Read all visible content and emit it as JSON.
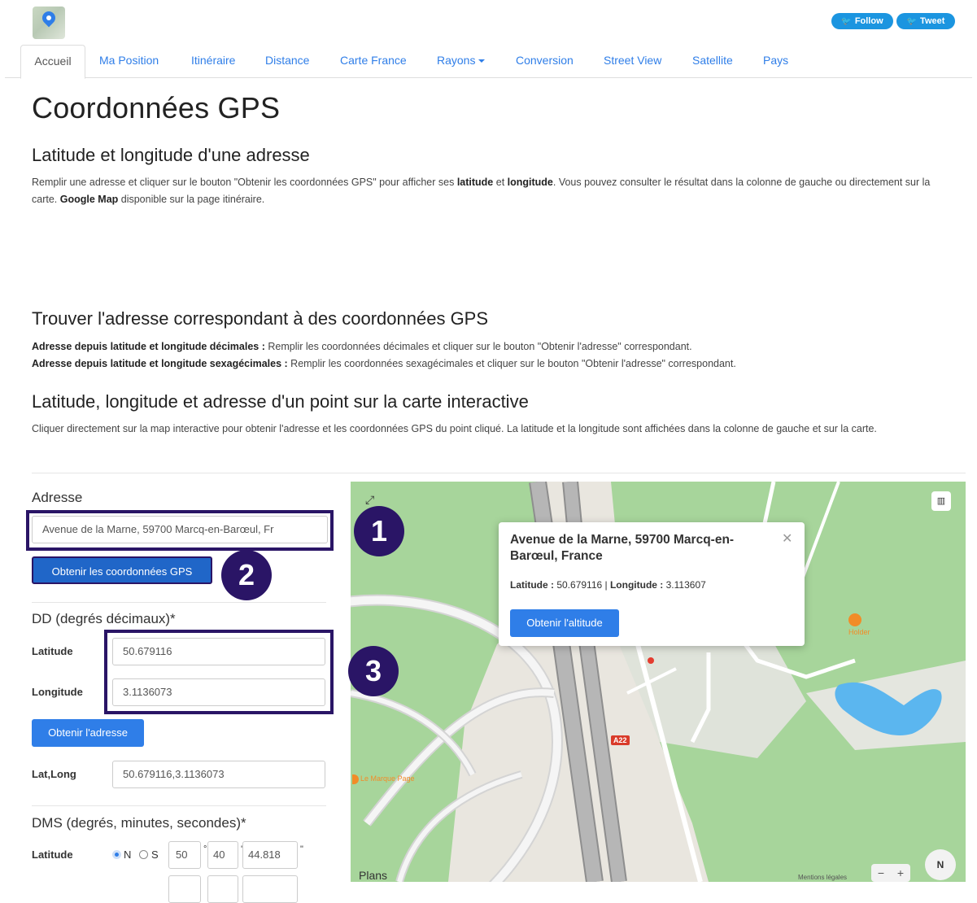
{
  "header": {
    "follow_label": "Follow",
    "tweet_label": "Tweet"
  },
  "nav": {
    "tabs": [
      "Accueil",
      "Ma Position",
      "Itinéraire",
      "Distance",
      "Carte France",
      "Rayons",
      "Conversion",
      "Street View",
      "Satellite",
      "Pays"
    ]
  },
  "page": {
    "title": "Coordonnées GPS",
    "section1_title": "Latitude et longitude d'une adresse",
    "section1_text": {
      "part1": "Remplir une adresse et cliquer sur le bouton \"Obtenir les coordonnées GPS\" pour afficher ses ",
      "bold1": "latitude",
      "part2": " et ",
      "bold2": "longitude",
      "part3": ". Vous pouvez consulter le résultat dans la colonne de gauche ou directement sur la carte. ",
      "bold3": "Google Map",
      "part4": " disponible sur la page itinéraire."
    },
    "section2_title": "Trouver l'adresse correspondant à des coordonnées GPS",
    "section2_line1_bold": "Adresse depuis latitude et longitude décimales :",
    "section2_line1": " Remplir les coordonnées décimales et cliquer sur le bouton \"Obtenir l'adresse\" correspondant.",
    "section2_line2_bold": "Adresse depuis latitude et longitude sexagécimales :",
    "section2_line2": " Remplir les coordonnées sexagécimales et cliquer sur le bouton \"Obtenir l'adresse\" correspondant.",
    "section3_title": "Latitude, longitude et adresse d'un point sur la carte interactive",
    "section3_text": "Cliquer directement sur la map interactive pour obtenir l'adresse et les coordonnées GPS du point cliqué. La latitude et la longitude sont affichées dans la colonne de gauche et sur la carte."
  },
  "form": {
    "address_label": "Adresse",
    "address_value": "Avenue de la Marne, 59700 Marcq-en-Barœul, Fr",
    "get_coords_button": "Obtenir les coordonnées GPS",
    "dd_title": "DD (degrés décimaux)*",
    "latitude_label": "Latitude",
    "latitude_value": "50.679116",
    "longitude_label": "Longitude",
    "longitude_value": "3.1136073",
    "get_address_button": "Obtenir l'adresse",
    "latlong_label": "Lat,Long",
    "latlong_value": "50.679116,3.1136073",
    "dms_title": "DMS (degrés, minutes, secondes)*",
    "dms_latitude_label": "Latitude",
    "dms_north": "N",
    "dms_south": "S",
    "dms_deg": "50",
    "dms_min": "40",
    "dms_sec": "44.818"
  },
  "annotations": {
    "badge1": "1",
    "badge2": "2",
    "badge3": "3"
  },
  "map": {
    "popup_title": "Avenue de la Marne, 59700 Marcq-en-Barœul, France",
    "popup_lat_label": "Latitude :",
    "popup_lat_value": " 50.679116",
    "popup_sep": " | ",
    "popup_lon_label": "Longitude :",
    "popup_lon_value": " 3.113607",
    "popup_button": "Obtenir l'altitude",
    "poi_holder": "Holder",
    "poi_marque_page": "Le Marque Page",
    "road_a22": "A22",
    "plans_label": "Plans",
    "legal_label": "Mentions légales",
    "compass_label": "N",
    "zoom_minus": "−",
    "zoom_plus": "+"
  },
  "colors": {
    "link": "#2f7ee8",
    "annotation": "#2a1566",
    "park": "#a7d59b"
  }
}
